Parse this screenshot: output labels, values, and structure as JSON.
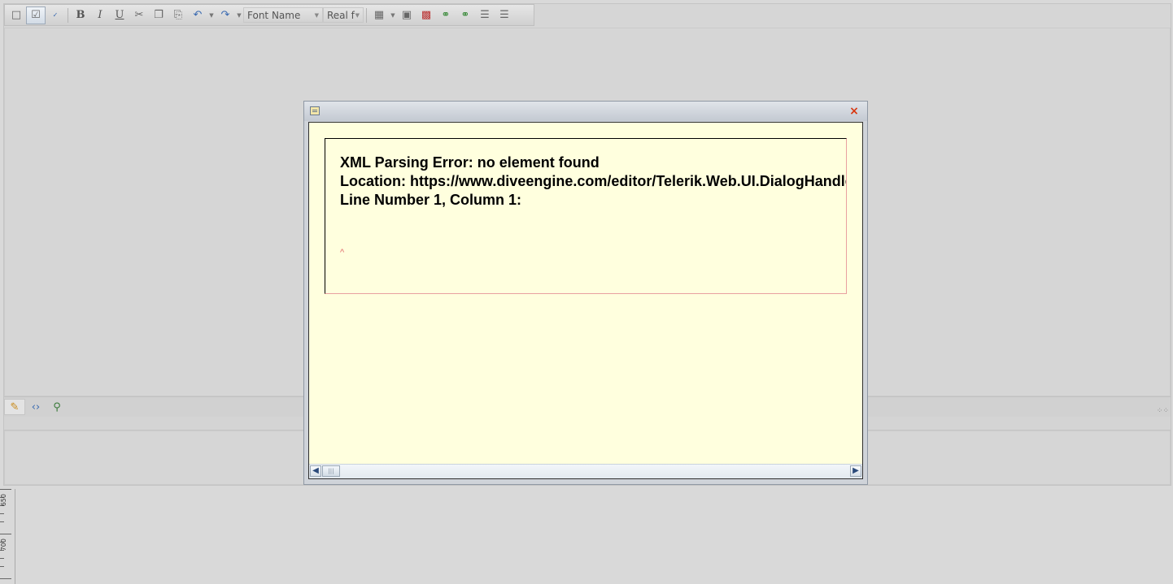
{
  "toolbar": {
    "font_name": "Font Name",
    "font_size": "Real f",
    "bold_label": "B",
    "italic_label": "I",
    "underline_label": "U",
    "icons": [
      "new-document-icon",
      "template-manager-icon",
      "spellcheck-icon",
      "cut-icon",
      "copy-icon",
      "paste-icon",
      "undo-icon",
      "redo-icon",
      "table-icon",
      "image-manager-icon",
      "flash-manager-icon",
      "hyperlink-icon",
      "remove-link-icon",
      "ordered-list-icon",
      "bulleted-list-icon"
    ]
  },
  "modes": {
    "design": "design-mode-icon",
    "html": "html-mode-icon",
    "preview": "preview-mode-icon"
  },
  "ruler": {
    "labels": [
      "650",
      "700"
    ]
  },
  "dialog": {
    "error_title": "XML Parsing Error: no element found",
    "error_location": "Location: https://www.diveengine.com/editor/Telerik.Web.UI.DialogHandler.aspx",
    "error_line": "Line Number 1, Column 1:",
    "caret": "^",
    "close_symbol": "×"
  },
  "colors": {
    "dialog_background": "#ffffde",
    "close_button": "#d8360e",
    "caret_color": "#e06a6a"
  }
}
